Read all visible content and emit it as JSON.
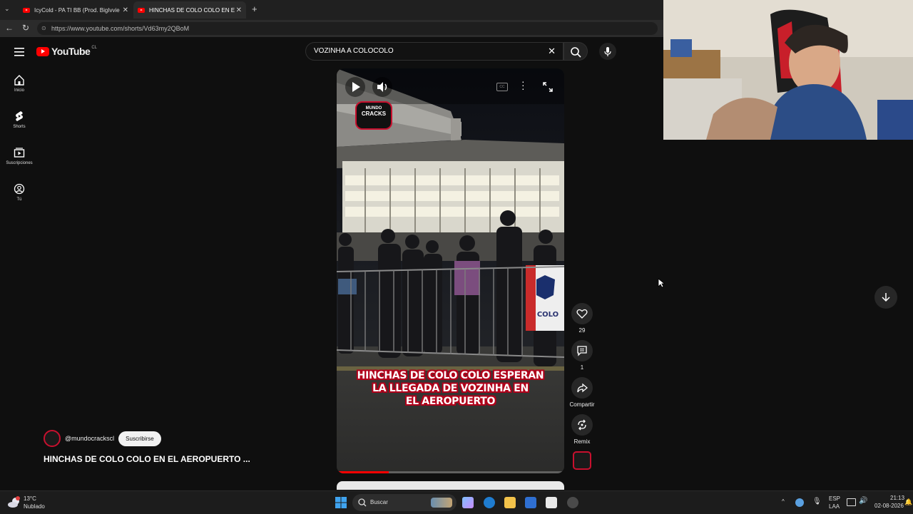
{
  "browser": {
    "tabs": [
      {
        "label": "IcyCold - PA TI BB (Prod. BigIvvier",
        "active": false
      },
      {
        "label": "HINCHAS DE COLO COLO EN EL A",
        "active": true
      }
    ],
    "new_tab": "+",
    "url": "https://www.youtube.com/shorts/Vd63my2QBoM"
  },
  "youtube": {
    "logo_text": "YouTube",
    "country_code": "CL",
    "search_query": "VOZINHA A COLOCOLO",
    "sidebar": [
      {
        "label": "Inicio",
        "icon": "home-icon"
      },
      {
        "label": "Shorts",
        "icon": "shorts-icon"
      },
      {
        "label": "Suscripciones",
        "icon": "subscriptions-icon"
      },
      {
        "label": "Tú",
        "icon": "user-icon"
      }
    ],
    "short": {
      "caption_lines": [
        "HINCHAS DE COLO COLO ESPERAN",
        "LA LLEGADA DE VOZINHA EN",
        "EL AEROPUERTO"
      ],
      "logo_text_1": "MUNDO",
      "logo_text_2": "CRACKS",
      "banner_text": "COLO",
      "progress": 0.23
    },
    "actions": {
      "likes": "29",
      "comments": "1",
      "share": "Compartir",
      "remix": "Remix"
    },
    "channel_handle": "@mundocrackscl",
    "subscribe_label": "Suscribirse",
    "video_title": "HINCHAS DE COLO COLO EN EL AEROPUERTO ..."
  },
  "taskbar": {
    "temperature": "13°C",
    "weather": "Nublado",
    "search_placeholder": "Buscar",
    "lang_top": "ESP",
    "lang_bottom": "LAA",
    "time": "21:13",
    "date": "02-08-2026"
  },
  "colors": {
    "accent": "#ff0000",
    "background": "#0f0f0f",
    "caption_outline": "#b0001a"
  }
}
